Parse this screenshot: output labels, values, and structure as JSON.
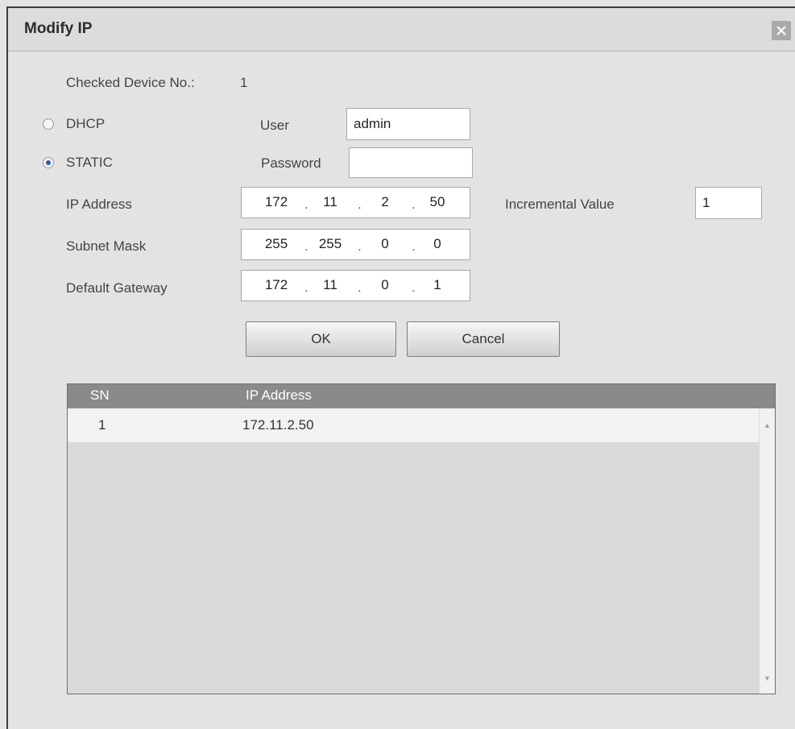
{
  "dialog": {
    "title": "Modify IP"
  },
  "form": {
    "checked_label": "Checked Device No.:",
    "checked_value": "1",
    "dhcp_label": "DHCP",
    "static_label": "STATIC",
    "selected_mode": "STATIC",
    "user_label": "User",
    "user_value": "admin",
    "password_label": "Password",
    "password_value": "",
    "ip_label": "IP Address",
    "ip": [
      "172",
      "11",
      "2",
      "50"
    ],
    "incremental_label": "Incremental Value",
    "incremental_value": "1",
    "subnet_label": "Subnet Mask",
    "subnet": [
      "255",
      "255",
      "0",
      "0"
    ],
    "gateway_label": "Default Gateway",
    "gateway": [
      "172",
      "11",
      "0",
      "1"
    ]
  },
  "buttons": {
    "ok": "OK",
    "cancel": "Cancel"
  },
  "table": {
    "columns": [
      "SN",
      "IP Address"
    ],
    "rows": [
      {
        "sn": "1",
        "ip": "172.11.2.50"
      }
    ]
  },
  "icons": {
    "close": "close-icon",
    "scroll_up": "scroll-up-arrow-icon",
    "scroll_down": "scroll-down-arrow-icon"
  }
}
